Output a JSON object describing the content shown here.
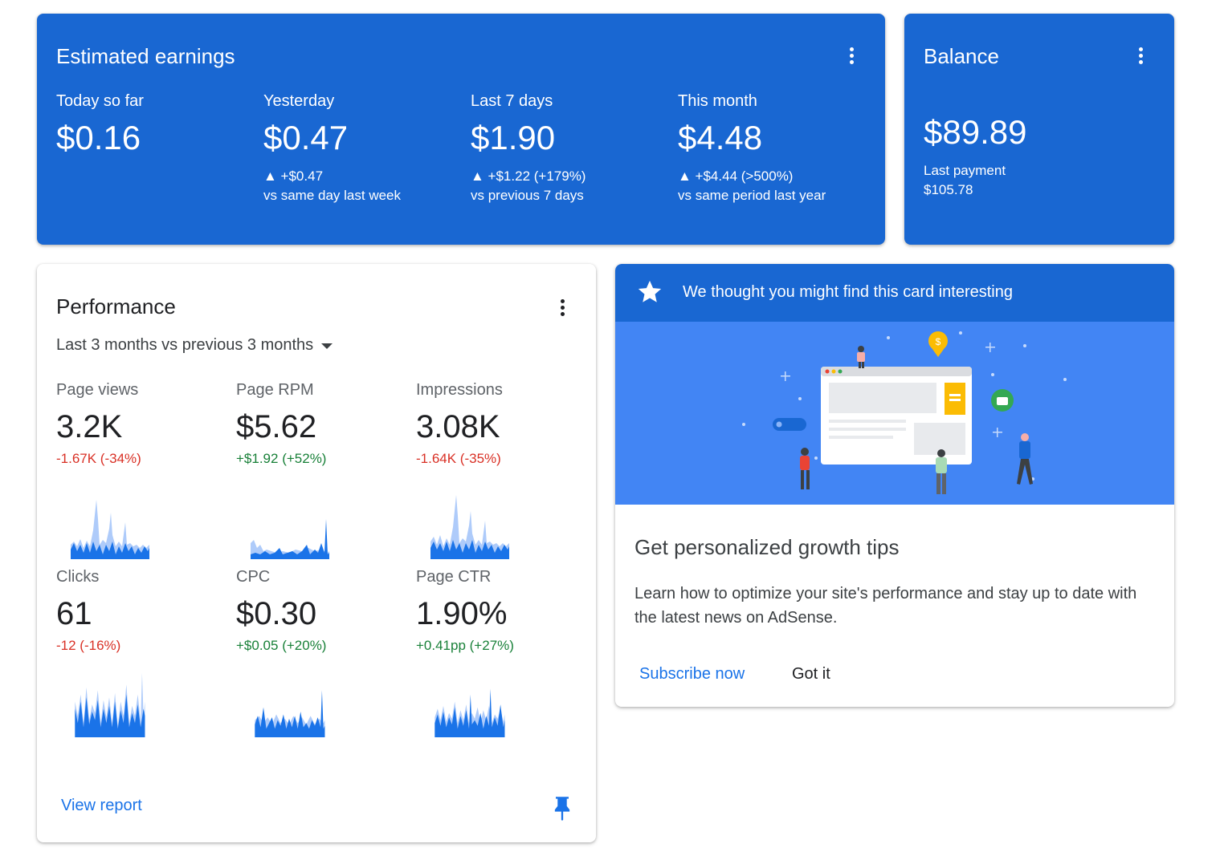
{
  "earnings": {
    "title": "Estimated earnings",
    "metrics": [
      {
        "label": "Today so far",
        "value": "$0.16",
        "change": "",
        "compare": ""
      },
      {
        "label": "Yesterday",
        "value": "$0.47",
        "change": "▲ +$0.47",
        "compare": "vs same day last week"
      },
      {
        "label": "Last 7 days",
        "value": "$1.90",
        "change": "▲ +$1.22 (+179%)",
        "compare": "vs previous 7 days"
      },
      {
        "label": "This month",
        "value": "$4.48",
        "change": "▲ +$4.44 (>500%)",
        "compare": "vs same period last year"
      }
    ]
  },
  "balance": {
    "title": "Balance",
    "value": "$89.89",
    "last_payment_label": "Last payment",
    "last_payment_value": "$105.78"
  },
  "performance": {
    "title": "Performance",
    "range": "Last 3 months vs previous 3 months",
    "metrics": [
      {
        "label": "Page views",
        "value": "3.2K",
        "change": "-1.67K (-34%)",
        "trend": "negative"
      },
      {
        "label": "Page RPM",
        "value": "$5.62",
        "change": "+$1.92 (+52%)",
        "trend": "positive"
      },
      {
        "label": "Impressions",
        "value": "3.08K",
        "change": "-1.64K (-35%)",
        "trend": "negative"
      },
      {
        "label": "Clicks",
        "value": "61",
        "change": "-12 (-16%)",
        "trend": "negative"
      },
      {
        "label": "CPC",
        "value": "$0.30",
        "change": "+$0.05 (+20%)",
        "trend": "positive"
      },
      {
        "label": "Page CTR",
        "value": "1.90%",
        "change": "+0.41pp (+27%)",
        "trend": "positive"
      }
    ],
    "view_report": "View report"
  },
  "tips": {
    "header": "We thought you might find this card interesting",
    "title": "Get personalized growth tips",
    "body": "Learn how to optimize your site's performance and stay up to date with the latest news on AdSense.",
    "subscribe": "Subscribe now",
    "dismiss": "Got it"
  },
  "colors": {
    "primary": "#1967d2",
    "accent": "#1a73e8",
    "negative": "#d93025",
    "positive": "#188038",
    "sparkline_current": "#1a73e8",
    "sparkline_previous": "#aecbfa"
  },
  "icons": {
    "menu": "more-vert-icon",
    "dropdown": "arrow-drop-down-icon",
    "pin": "pin-icon",
    "star": "star-icon"
  }
}
